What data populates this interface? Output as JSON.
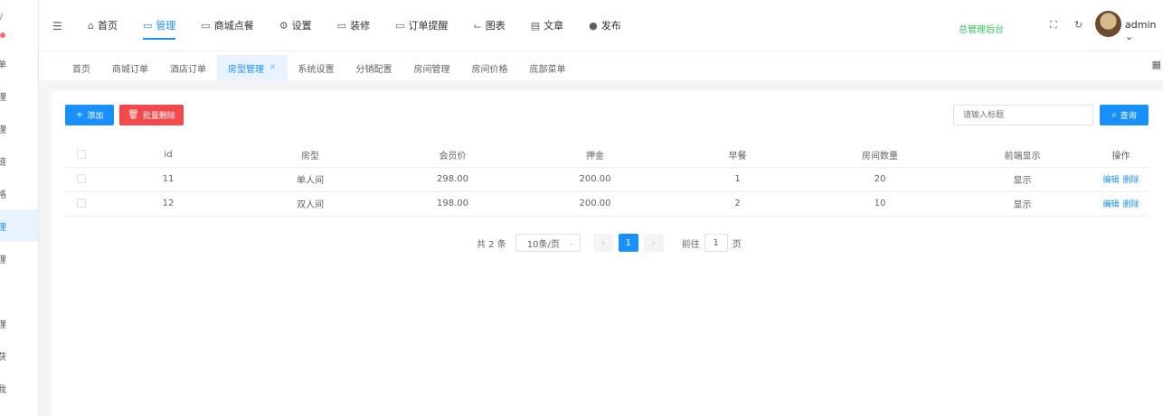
{
  "sidebar": {
    "items": [
      {
        "label": "单"
      },
      {
        "label": "理"
      },
      {
        "label": "理"
      },
      {
        "label": "链"
      },
      {
        "label": "格"
      },
      {
        "label": "理",
        "active": true
      },
      {
        "label": "理"
      },
      {
        "label": "理"
      },
      {
        "label": "获"
      },
      {
        "label": "我"
      }
    ]
  },
  "nav": {
    "items": [
      {
        "label": "首页",
        "icon": "home-icon"
      },
      {
        "label": "管理",
        "icon": "monitor-icon",
        "active": true
      },
      {
        "label": "商城点餐",
        "icon": "message-icon"
      },
      {
        "label": "设置",
        "icon": "gear-icon"
      },
      {
        "label": "装修",
        "icon": "monitor-icon"
      },
      {
        "label": "订单提醒",
        "icon": "message-icon"
      },
      {
        "label": "图表",
        "icon": "chart-icon"
      },
      {
        "label": "文章",
        "icon": "document-icon"
      },
      {
        "label": "发布",
        "icon": "chat-icon"
      }
    ],
    "admin_link": "总管理后台",
    "user": "admin"
  },
  "tabs": [
    {
      "label": "首页"
    },
    {
      "label": "商城订单"
    },
    {
      "label": "酒店订单"
    },
    {
      "label": "房型管理",
      "active": true,
      "closable": true
    },
    {
      "label": "系统设置"
    },
    {
      "label": "分销配置"
    },
    {
      "label": "房间管理"
    },
    {
      "label": "房间价格"
    },
    {
      "label": "底部菜单"
    }
  ],
  "toolbar": {
    "add_label": "添加",
    "batch_delete_label": "批量删除",
    "search_placeholder": "请输入标题",
    "search_label": "查询"
  },
  "table": {
    "headers": [
      "id",
      "房型",
      "会员价",
      "押金",
      "早餐",
      "房间数量",
      "前端显示",
      "操作"
    ],
    "rows": [
      {
        "id": "11",
        "room_type": "单人间",
        "member_price": "298.00",
        "deposit": "200.00",
        "breakfast": "1",
        "room_count": "20",
        "display": "显示"
      },
      {
        "id": "12",
        "room_type": "双人间",
        "member_price": "198.00",
        "deposit": "200.00",
        "breakfast": "2",
        "room_count": "10",
        "display": "显示"
      }
    ],
    "edit_label": "编辑",
    "delete_label": "删除"
  },
  "pagination": {
    "total": "共 2 条",
    "page_size": "10条/页",
    "current_page": "1",
    "goto_label": "前往",
    "goto_value": "1",
    "page_suffix": "页"
  },
  "colors": {
    "primary": "#1890ff",
    "danger": "#f5484d",
    "admin_link": "#36c75b"
  }
}
